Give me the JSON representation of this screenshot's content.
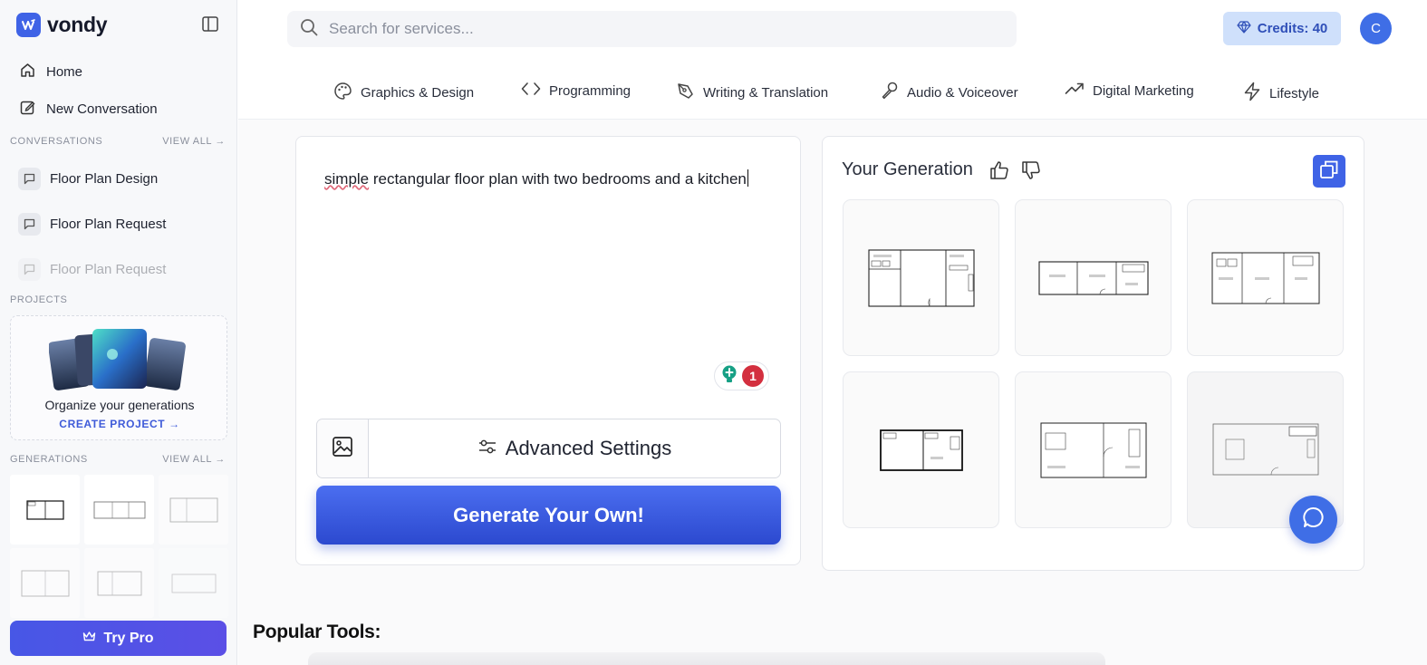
{
  "sidebar": {
    "brand": "vondy",
    "nav": [
      {
        "label": "Home",
        "icon": "home-icon"
      },
      {
        "label": "New Conversation",
        "icon": "edit-icon"
      }
    ],
    "conversations_label": "CONVERSATIONS",
    "view_all_label": "VIEW ALL →",
    "conversations": [
      {
        "label": "Floor Plan Design"
      },
      {
        "label": "Floor Plan Request"
      },
      {
        "label": "Floor Plan Request"
      }
    ],
    "projects_label": "PROJECTS",
    "project_card": {
      "text": "Organize your generations",
      "link": "CREATE PROJECT"
    },
    "generations_label": "GENERATIONS",
    "try_pro_label": "Try Pro"
  },
  "header": {
    "search_placeholder": "Search for services...",
    "credits_label": "Credits: 40",
    "avatar_initial": "C",
    "categories": [
      {
        "label": "Graphics & Design",
        "icon": "palette-icon"
      },
      {
        "label": "Programming",
        "icon": "code-icon"
      },
      {
        "label": "Writing & Translation",
        "icon": "pen-icon"
      },
      {
        "label": "Audio & Voiceover",
        "icon": "microphone-icon"
      },
      {
        "label": "Digital Marketing",
        "icon": "trending-up-icon"
      },
      {
        "label": "Lifestyle",
        "icon": "lightning-icon"
      }
    ]
  },
  "prompt": {
    "text_first": "simple",
    "text_rest": " rectangular floor plan with two bedrooms and a kitchen",
    "grammarly_count": "1",
    "advanced_settings_label": "Advanced Settings",
    "generate_label": "Generate Your Own!"
  },
  "generation": {
    "title": "Your Generation"
  },
  "popular_tools_label": "Popular Tools:",
  "colors": {
    "accent": "#3f63e6",
    "credits_bg": "#cfe0fb",
    "grammarly_badge": "#d32f3f"
  }
}
